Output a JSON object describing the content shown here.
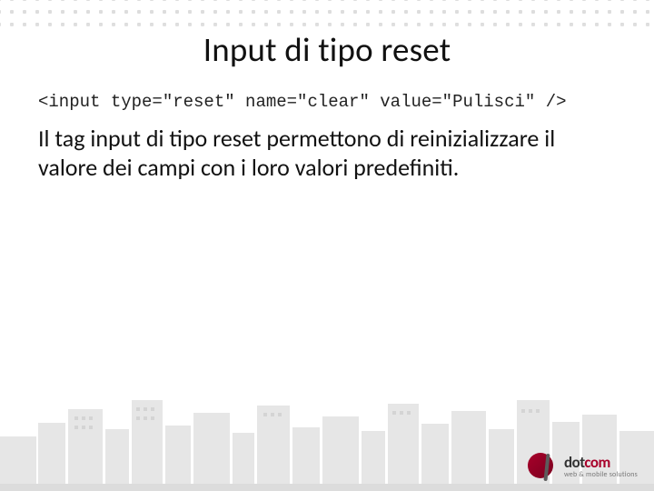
{
  "title": "Input di tipo reset",
  "code": "<input type=\"reset\" name=\"clear\" value=\"Pulisci\" />",
  "body": "Il tag input di tipo reset permettono di reinizializzare il valore dei campi con i loro valori predefiniti.",
  "logo": {
    "brand_prefix": "dot",
    "brand_suffix": "com",
    "tagline": "web & mobile solutions"
  }
}
